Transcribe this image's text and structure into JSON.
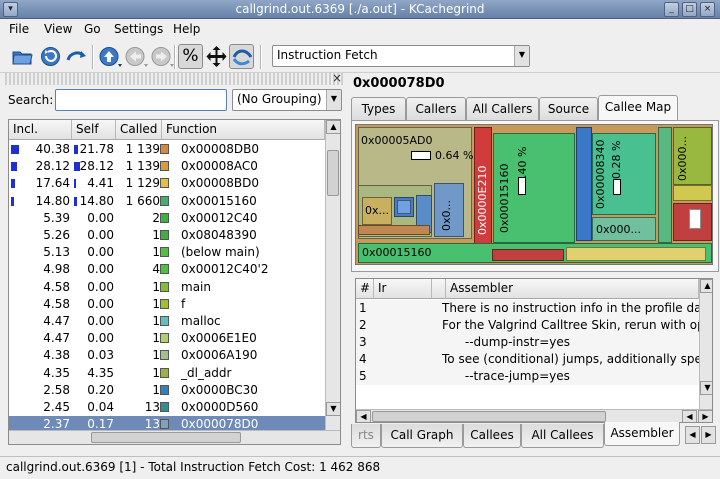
{
  "window": {
    "title": "callgrind.out.6369 [./a.out] - KCachegrind"
  },
  "menu": [
    "File",
    "View",
    "Go",
    "Settings",
    "Help"
  ],
  "toolbar": {
    "percent_label": "%",
    "event_type": "Instruction Fetch"
  },
  "left": {
    "search_label": "Search:",
    "search_value": "",
    "grouping": "(No Grouping)",
    "columns": [
      "Incl.",
      "Self",
      "Called",
      "Function"
    ],
    "rows": [
      {
        "incl": "40.38",
        "self": "21.78",
        "called": "1 139",
        "name": "0x00008DB0",
        "color": "#d8883a",
        "bar_incl": 0.4,
        "bar_self": 0.22
      },
      {
        "incl": "28.12",
        "self": "28.12",
        "called": "1 139",
        "name": "0x00008AC0",
        "color": "#d89a3a",
        "bar_incl": 0.28,
        "bar_self": 0.28
      },
      {
        "incl": "17.64",
        "self": "4.41",
        "called": "1 129",
        "name": "0x00008BD0",
        "color": "#e0c040",
        "bar_incl": 0.18,
        "bar_self": 0.04
      },
      {
        "incl": "14.80",
        "self": "14.80",
        "called": "1 660",
        "name": "0x00015160",
        "color": "#40b070",
        "bar_incl": 0.15,
        "bar_self": 0.15
      },
      {
        "incl": "5.39",
        "self": "0.00",
        "called": "2",
        "name": "0x00012C40",
        "color": "#3cb040",
        "bar_incl": 0,
        "bar_self": 0
      },
      {
        "incl": "5.26",
        "self": "0.00",
        "called": "1",
        "name": "0x08048390",
        "color": "#3cb040",
        "bar_incl": 0,
        "bar_self": 0
      },
      {
        "incl": "5.13",
        "self": "0.00",
        "called": "1",
        "name": "(below main)",
        "color": "#50c040",
        "bar_incl": 0,
        "bar_self": 0
      },
      {
        "incl": "4.98",
        "self": "0.00",
        "called": "4",
        "name": "0x00012C40'2",
        "color": "#50c040",
        "bar_incl": 0,
        "bar_self": 0
      },
      {
        "incl": "4.58",
        "self": "0.00",
        "called": "1",
        "name": "main",
        "color": "#80c030",
        "bar_incl": 0,
        "bar_self": 0
      },
      {
        "incl": "4.58",
        "self": "0.00",
        "called": "1",
        "name": "f",
        "color": "#a0c030",
        "bar_incl": 0,
        "bar_self": 0
      },
      {
        "incl": "4.47",
        "self": "0.00",
        "called": "1",
        "name": "malloc",
        "color": "#60c0c0",
        "bar_incl": 0,
        "bar_self": 0
      },
      {
        "incl": "4.47",
        "self": "0.00",
        "called": "1",
        "name": "0x0006E1E0",
        "color": "#b0d070",
        "bar_incl": 0,
        "bar_self": 0
      },
      {
        "incl": "4.38",
        "self": "0.03",
        "called": "1",
        "name": "0x0006A190",
        "color": "#a0c090",
        "bar_incl": 0,
        "bar_self": 0
      },
      {
        "incl": "4.35",
        "self": "4.35",
        "called": "1",
        "name": "_dl_addr",
        "color": "#a0b040",
        "bar_incl": 0,
        "bar_self": 0
      },
      {
        "incl": "2.58",
        "self": "0.20",
        "called": "1",
        "name": "0x0000BC30",
        "color": "#3080c0",
        "bar_incl": 0,
        "bar_self": 0
      },
      {
        "incl": "2.45",
        "self": "0.04",
        "called": "13",
        "name": "0x0000D560",
        "color": "#309090",
        "bar_incl": 0,
        "bar_self": 0
      },
      {
        "incl": "2.37",
        "self": "0.17",
        "called": "13",
        "name": "0x000078D0",
        "color": "#80a0c0",
        "bar_incl": 0,
        "bar_self": 0,
        "selected": true
      }
    ]
  },
  "right": {
    "title": "0x000078D0",
    "top_tabs": [
      "Types",
      "Callers",
      "All Callers",
      "Source",
      "Callee Map"
    ],
    "treemap": {
      "big_label": "0x00005AD0",
      "big_pct": "0.64 %",
      "red_label": "0x0000E210",
      "green_label": "0x00015160",
      "green_pct": "0.40 %",
      "blue_label": "0x00008340",
      "blue_pct": "0.28 %",
      "right_label": "0x000...",
      "small1": "0x...",
      "small2": "0x0...",
      "small3": "0x000...",
      "bottom_label": "0x00015160"
    },
    "asm": {
      "columns": [
        "#",
        "Ir",
        "Assembler"
      ],
      "rows": [
        {
          "n": "1",
          "text": "There is no instruction info in the profile data fil"
        },
        {
          "n": "2",
          "text": "For the Valgrind Calltree Skin, rerun with option"
        },
        {
          "n": "3",
          "text": "      --dump-instr=yes"
        },
        {
          "n": "4",
          "text": "To see (conditional) jumps, additionally specify"
        },
        {
          "n": "5",
          "text": "      --trace-jump=yes"
        }
      ]
    },
    "bottom_tabs": [
      "rts",
      "Call Graph",
      "Callees",
      "All Callees",
      "Assembler"
    ]
  },
  "status": "callgrind.out.6369 [1] - Total Instruction Fetch Cost:  1 462 868"
}
